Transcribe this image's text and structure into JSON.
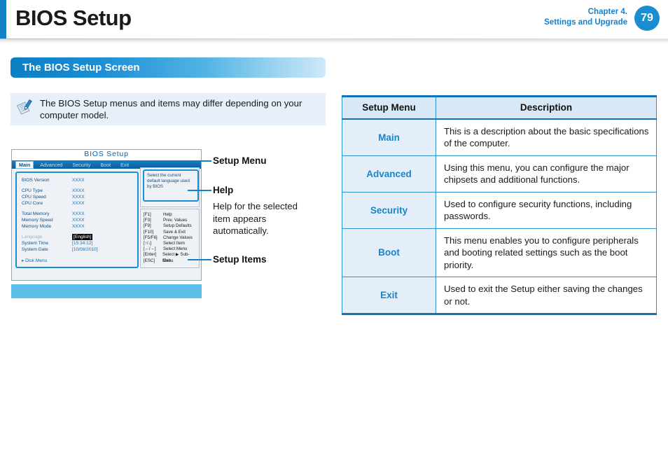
{
  "header": {
    "title": "BIOS Setup",
    "chapter_line1": "Chapter 4.",
    "chapter_line2": "Settings and Upgrade",
    "page_number": "79",
    "accent_color": "#1480c8"
  },
  "section": {
    "heading": "The BIOS Setup Screen"
  },
  "note": {
    "icon": "note-pen-icon",
    "text": "The BIOS Setup menus and items may differ depending on your computer model."
  },
  "bios_figure": {
    "title": "BIOS  Setup",
    "menu_items": [
      {
        "label": "Main",
        "active": true
      },
      {
        "label": "Advanced",
        "active": false
      },
      {
        "label": "Security",
        "active": false
      },
      {
        "label": "Boot",
        "active": false
      },
      {
        "label": "Exit",
        "active": false
      }
    ],
    "items": [
      {
        "key": "BIOS Version",
        "value": "XXXX",
        "highlight": false,
        "dim": false
      },
      {
        "key": "",
        "value": "",
        "gap": true
      },
      {
        "key": "CPU Type",
        "value": "XXXX",
        "highlight": false,
        "dim": false
      },
      {
        "key": "CPU Speed",
        "value": "XXXX",
        "highlight": false,
        "dim": false
      },
      {
        "key": "CPU Core",
        "value": "XXXX",
        "highlight": false,
        "dim": false
      },
      {
        "key": "",
        "value": "",
        "gap": true
      },
      {
        "key": "Total Memory",
        "value": "XXXX",
        "highlight": false,
        "dim": false
      },
      {
        "key": "Memory Speed",
        "value": "XXXX",
        "highlight": false,
        "dim": false
      },
      {
        "key": "Memory Mode",
        "value": "XXXX",
        "highlight": false,
        "dim": false
      },
      {
        "key": "",
        "value": "",
        "gap": true
      },
      {
        "key": "Language",
        "value": "[English]",
        "highlight": true,
        "dim": true
      },
      {
        "key": "System Time",
        "value": "[15:34:12]",
        "highlight": false,
        "dim": false
      },
      {
        "key": "System Date",
        "value": "[10/08/2010]",
        "highlight": false,
        "dim": false
      }
    ],
    "disk_menu": "Disk Menu",
    "help_text": "Select the current default language used by BIOS",
    "keys": [
      {
        "key": "[F1]",
        "action": "Help"
      },
      {
        "key": "[F3]",
        "action": "Prev. Values"
      },
      {
        "key": "[F9]",
        "action": "Setup Defaults"
      },
      {
        "key": "[F10]",
        "action": "Save & Exit"
      },
      {
        "key": "[F5/F6]",
        "action": "Change Values"
      },
      {
        "key": "[↑/↓]",
        "action": "Select Item"
      },
      {
        "key": "[←/→]",
        "action": "Select Menu"
      },
      {
        "key": "[Enter]",
        "action": "Select ▶ Sub-Menu"
      },
      {
        "key": "[ESC]",
        "action": "Exit"
      }
    ]
  },
  "callouts": {
    "setup_menu": "Setup Menu",
    "help_title": "Help",
    "help_body": "Help for the selected item appears automatically.",
    "setup_items": "Setup Items"
  },
  "table": {
    "headers": [
      "Setup Menu",
      "Description"
    ],
    "rows": [
      {
        "menu": "Main",
        "description": "This is a description about the basic specifications of the computer."
      },
      {
        "menu": "Advanced",
        "description": "Using this menu, you can configure the major chipsets and additional functions."
      },
      {
        "menu": "Security",
        "description": "Used to configure security functions, including passwords."
      },
      {
        "menu": "Boot",
        "description": "This menu enables you to configure peripherals and booting related settings such as the boot priority."
      },
      {
        "menu": "Exit",
        "description": "Used to exit the Setup either saving the changes or not."
      }
    ]
  }
}
